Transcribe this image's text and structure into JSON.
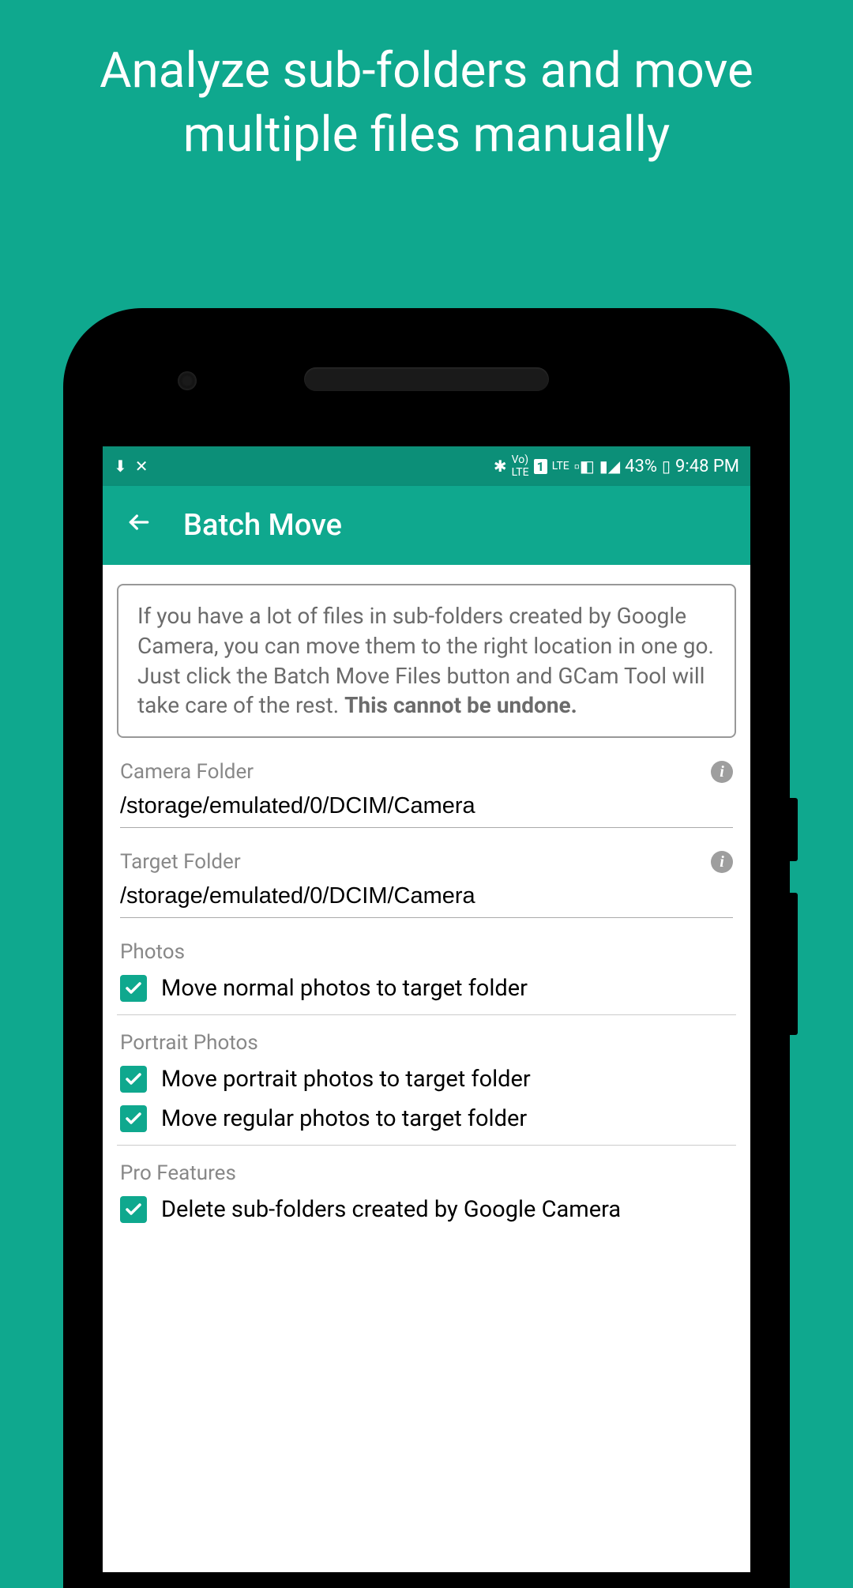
{
  "promo": {
    "headline": "Analyze sub-folders and move multiple files manually"
  },
  "status_bar": {
    "battery_text": "43%",
    "time": "9:48 PM"
  },
  "app_bar": {
    "title": "Batch Move"
  },
  "info_box": {
    "text": "If you have a lot of files in sub-folders created by Google Camera, you can move them to the right location in one go. Just click the Batch Move Files button and GCam Tool will take care of the rest. ",
    "bold": "This cannot be undone."
  },
  "fields": {
    "camera_folder": {
      "label": "Camera Folder",
      "value": "/storage/emulated/0/DCIM/Camera"
    },
    "target_folder": {
      "label": "Target Folder",
      "value": "/storage/emulated/0/DCIM/Camera"
    }
  },
  "sections": {
    "photos": {
      "title": "Photos",
      "options": [
        {
          "label": "Move normal photos to target folder",
          "checked": true
        }
      ]
    },
    "portrait": {
      "title": "Portrait Photos",
      "options": [
        {
          "label": "Move portrait photos to target folder",
          "checked": true
        },
        {
          "label": "Move regular photos to target folder",
          "checked": true
        }
      ]
    },
    "pro": {
      "title": "Pro Features",
      "options": [
        {
          "label": "Delete sub-folders created by Google Camera",
          "checked": true
        }
      ]
    }
  }
}
